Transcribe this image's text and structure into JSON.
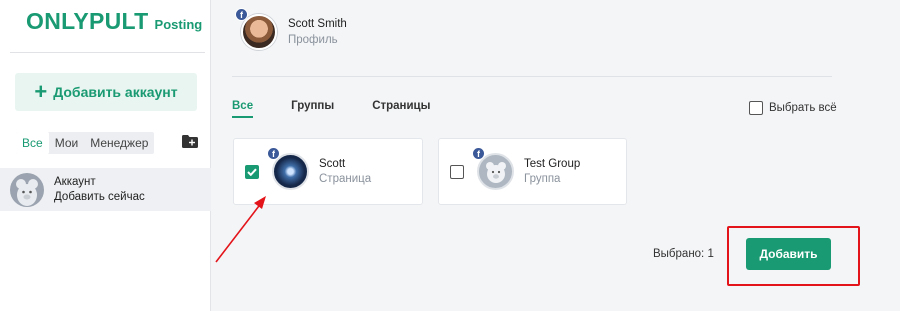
{
  "sidebar": {
    "logo_main": "ONLYPULT",
    "logo_sub": "Posting",
    "add_account_label": "Добавить аккаунт",
    "filters": [
      "Все",
      "Мои",
      "Менеджер"
    ],
    "account": {
      "title": "Аккаунт",
      "subtitle": "Добавить сейчас"
    }
  },
  "profile": {
    "name": "Scott Smith",
    "subtitle": "Профиль"
  },
  "tabs": [
    "Все",
    "Группы",
    "Страницы"
  ],
  "select_all_label": "Выбрать всё",
  "cards": [
    {
      "name": "Scott",
      "type": "Страница",
      "checked": true
    },
    {
      "name": "Test Group",
      "type": "Группа",
      "checked": false
    }
  ],
  "selected_label": "Выбрано: 1",
  "add_button_label": "Добавить",
  "colors": {
    "accent": "#1a9a72",
    "facebook": "#3b5998",
    "annotation_red": "#e3141a"
  }
}
